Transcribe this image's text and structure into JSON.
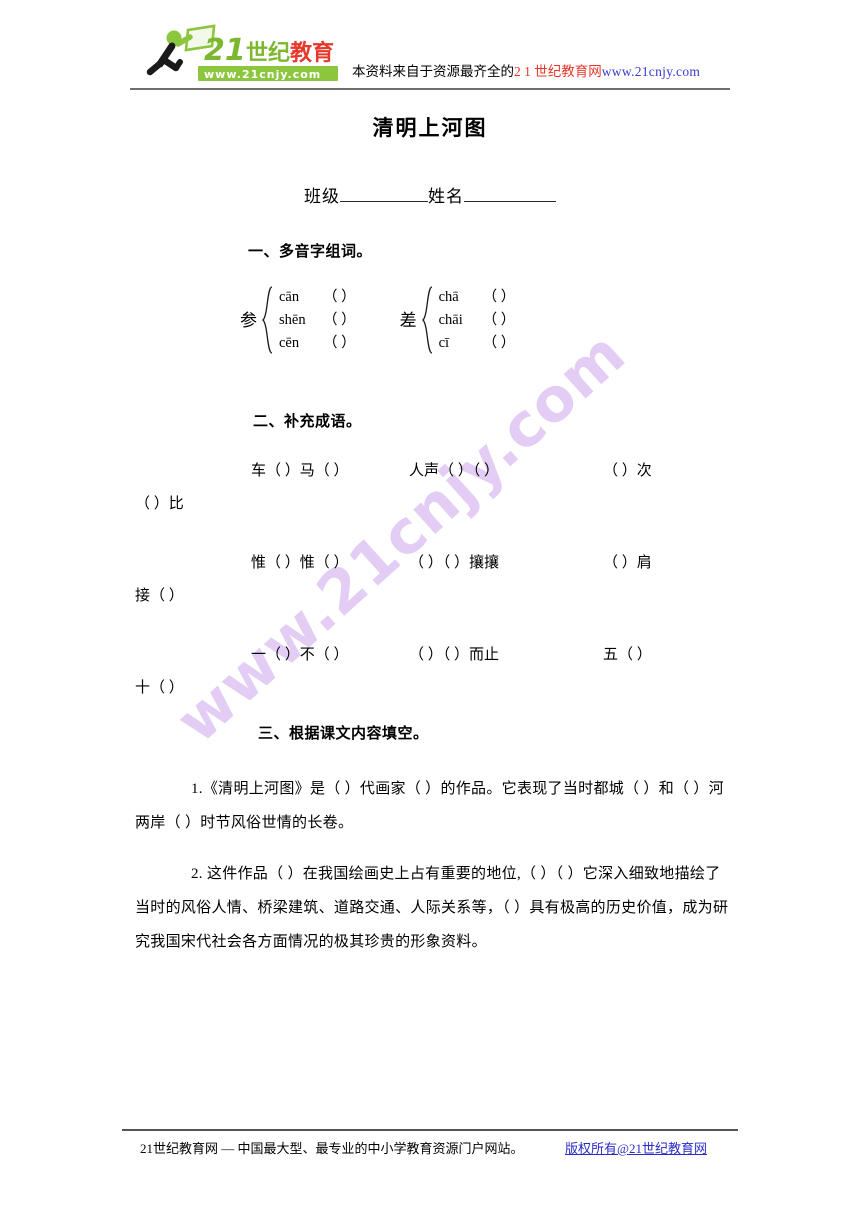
{
  "header": {
    "logo": {
      "brand_cn": "21世纪教育",
      "brand_url": "www.21cnjy.com",
      "icon": "running-person-with-flag-logo"
    },
    "note_prefix": "本资料来自于资源最齐全的",
    "note_brand": "2 1 世纪教育网",
    "note_url": "www.21cnjy.com"
  },
  "watermark": {
    "text": "www.21cnjy.com",
    "color": "#e3cdf4"
  },
  "title": "清明上河图",
  "name_line": {
    "class_label": "班级",
    "name_label": "姓名"
  },
  "sections": {
    "one": {
      "heading": "一、多音字组词。",
      "groups": [
        {
          "char": "参",
          "rows": [
            {
              "pinyin": "cān",
              "answer": "（        ）"
            },
            {
              "pinyin": "shēn",
              "answer": "（        ）"
            },
            {
              "pinyin": "cēn",
              "answer": "（        ）"
            }
          ]
        },
        {
          "char": "差",
          "rows": [
            {
              "pinyin": "chā",
              "answer": "（        ）"
            },
            {
              "pinyin": "chāi",
              "answer": "（        ）"
            },
            {
              "pinyin": "cī",
              "answer": "（        ）"
            }
          ]
        }
      ]
    },
    "two": {
      "heading": "二、补充成语。",
      "rows": [
        {
          "cells": [
            "车（    ）马（    ）",
            "人声（    ）（    ）",
            "（    ）次"
          ],
          "wrap": "（    ）比"
        },
        {
          "cells": [
            "惟（    ）惟（    ）",
            "（    ）（    ）攘攘",
            "（    ）肩"
          ],
          "wrap": "接（    ）"
        },
        {
          "cells": [
            "一（    ）不（    ）",
            "（    ）（    ）而止",
            "五（    ）"
          ],
          "wrap": "十（    ）"
        }
      ]
    },
    "three": {
      "heading": "三、根据课文内容填空。",
      "questions": [
        "1.《清明上河图》是（        ）代画家（        ）的作品。它表现了当时都城（        ）和（        ）河两岸（        ）时节风俗世情的长卷。",
        "2. 这件作品（        ）在我国绘画史上占有重要的地位,（        ）（        ）它深入细致地描绘了当时的风俗人情、桥梁建筑、道路交通、人际关系等，（        ）具有极高的历史价值，成为研究我国宋代社会各方面情况的极其珍贵的形象资料。"
      ]
    }
  },
  "footer": {
    "text": "21世纪教育网 — 中国最大型、最专业的中小学教育资源门户网站。",
    "link": "版权所有@21世纪教育网"
  }
}
